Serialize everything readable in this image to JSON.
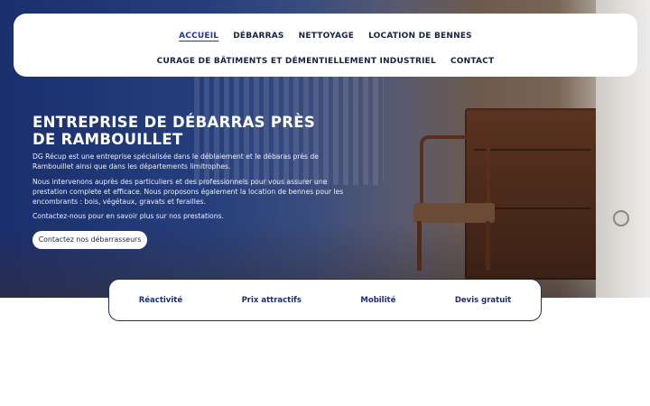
{
  "nav": {
    "row1": [
      "ACCUEIL",
      "DÉBARRAS",
      "NETTOYAGE",
      "LOCATION DE BENNES"
    ],
    "row2": [
      "CURAGE DE BÂTIMENTS ET DÉMENTIELLEMENT INDUSTRIEL",
      "CONTACT"
    ],
    "active": "ACCUEIL"
  },
  "hero": {
    "title": "ENTREPRISE DE DÉBARRAS PRÈS DE RAMBOUILLET",
    "paragraph1": "DG Récup est une entreprise spécialisée dans le déblaiement et le débaras  près de Rambouillet ainsi que dans les départements limitrophes.",
    "paragraph2": "Nous intervenons auprès des particuliers et des professionnels pour vous assurer une prestation complete et efficace. Nous proposons également la location de bennes pour les encombrants : bois, végétaux, gravats et ferailles.",
    "paragraph3": "Contactez-nous pour en savoir plus sur nos prestations.",
    "cta_label": "Contactez nos débarrasseurs"
  },
  "features": [
    "Réactivité",
    "Prix attractifs",
    "Mobilité",
    "Devis gratuit"
  ],
  "colors": {
    "navy": "#1f2e6b",
    "hero_blue": "#1a2f6e",
    "white": "#ffffff"
  }
}
